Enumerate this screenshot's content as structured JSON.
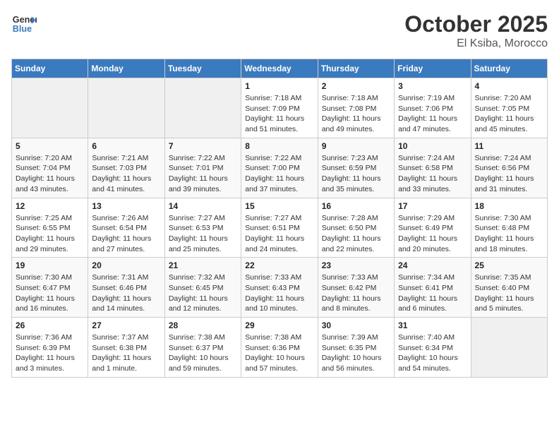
{
  "header": {
    "logo_line1": "General",
    "logo_line2": "Blue",
    "month": "October 2025",
    "location": "El Ksiba, Morocco"
  },
  "weekdays": [
    "Sunday",
    "Monday",
    "Tuesday",
    "Wednesday",
    "Thursday",
    "Friday",
    "Saturday"
  ],
  "weeks": [
    [
      {
        "day": "",
        "info": ""
      },
      {
        "day": "",
        "info": ""
      },
      {
        "day": "",
        "info": ""
      },
      {
        "day": "1",
        "info": "Sunrise: 7:18 AM\nSunset: 7:09 PM\nDaylight: 11 hours\nand 51 minutes."
      },
      {
        "day": "2",
        "info": "Sunrise: 7:18 AM\nSunset: 7:08 PM\nDaylight: 11 hours\nand 49 minutes."
      },
      {
        "day": "3",
        "info": "Sunrise: 7:19 AM\nSunset: 7:06 PM\nDaylight: 11 hours\nand 47 minutes."
      },
      {
        "day": "4",
        "info": "Sunrise: 7:20 AM\nSunset: 7:05 PM\nDaylight: 11 hours\nand 45 minutes."
      }
    ],
    [
      {
        "day": "5",
        "info": "Sunrise: 7:20 AM\nSunset: 7:04 PM\nDaylight: 11 hours\nand 43 minutes."
      },
      {
        "day": "6",
        "info": "Sunrise: 7:21 AM\nSunset: 7:03 PM\nDaylight: 11 hours\nand 41 minutes."
      },
      {
        "day": "7",
        "info": "Sunrise: 7:22 AM\nSunset: 7:01 PM\nDaylight: 11 hours\nand 39 minutes."
      },
      {
        "day": "8",
        "info": "Sunrise: 7:22 AM\nSunset: 7:00 PM\nDaylight: 11 hours\nand 37 minutes."
      },
      {
        "day": "9",
        "info": "Sunrise: 7:23 AM\nSunset: 6:59 PM\nDaylight: 11 hours\nand 35 minutes."
      },
      {
        "day": "10",
        "info": "Sunrise: 7:24 AM\nSunset: 6:58 PM\nDaylight: 11 hours\nand 33 minutes."
      },
      {
        "day": "11",
        "info": "Sunrise: 7:24 AM\nSunset: 6:56 PM\nDaylight: 11 hours\nand 31 minutes."
      }
    ],
    [
      {
        "day": "12",
        "info": "Sunrise: 7:25 AM\nSunset: 6:55 PM\nDaylight: 11 hours\nand 29 minutes."
      },
      {
        "day": "13",
        "info": "Sunrise: 7:26 AM\nSunset: 6:54 PM\nDaylight: 11 hours\nand 27 minutes."
      },
      {
        "day": "14",
        "info": "Sunrise: 7:27 AM\nSunset: 6:53 PM\nDaylight: 11 hours\nand 25 minutes."
      },
      {
        "day": "15",
        "info": "Sunrise: 7:27 AM\nSunset: 6:51 PM\nDaylight: 11 hours\nand 24 minutes."
      },
      {
        "day": "16",
        "info": "Sunrise: 7:28 AM\nSunset: 6:50 PM\nDaylight: 11 hours\nand 22 minutes."
      },
      {
        "day": "17",
        "info": "Sunrise: 7:29 AM\nSunset: 6:49 PM\nDaylight: 11 hours\nand 20 minutes."
      },
      {
        "day": "18",
        "info": "Sunrise: 7:30 AM\nSunset: 6:48 PM\nDaylight: 11 hours\nand 18 minutes."
      }
    ],
    [
      {
        "day": "19",
        "info": "Sunrise: 7:30 AM\nSunset: 6:47 PM\nDaylight: 11 hours\nand 16 minutes."
      },
      {
        "day": "20",
        "info": "Sunrise: 7:31 AM\nSunset: 6:46 PM\nDaylight: 11 hours\nand 14 minutes."
      },
      {
        "day": "21",
        "info": "Sunrise: 7:32 AM\nSunset: 6:45 PM\nDaylight: 11 hours\nand 12 minutes."
      },
      {
        "day": "22",
        "info": "Sunrise: 7:33 AM\nSunset: 6:43 PM\nDaylight: 11 hours\nand 10 minutes."
      },
      {
        "day": "23",
        "info": "Sunrise: 7:33 AM\nSunset: 6:42 PM\nDaylight: 11 hours\nand 8 minutes."
      },
      {
        "day": "24",
        "info": "Sunrise: 7:34 AM\nSunset: 6:41 PM\nDaylight: 11 hours\nand 6 minutes."
      },
      {
        "day": "25",
        "info": "Sunrise: 7:35 AM\nSunset: 6:40 PM\nDaylight: 11 hours\nand 5 minutes."
      }
    ],
    [
      {
        "day": "26",
        "info": "Sunrise: 7:36 AM\nSunset: 6:39 PM\nDaylight: 11 hours\nand 3 minutes."
      },
      {
        "day": "27",
        "info": "Sunrise: 7:37 AM\nSunset: 6:38 PM\nDaylight: 11 hours\nand 1 minute."
      },
      {
        "day": "28",
        "info": "Sunrise: 7:38 AM\nSunset: 6:37 PM\nDaylight: 10 hours\nand 59 minutes."
      },
      {
        "day": "29",
        "info": "Sunrise: 7:38 AM\nSunset: 6:36 PM\nDaylight: 10 hours\nand 57 minutes."
      },
      {
        "day": "30",
        "info": "Sunrise: 7:39 AM\nSunset: 6:35 PM\nDaylight: 10 hours\nand 56 minutes."
      },
      {
        "day": "31",
        "info": "Sunrise: 7:40 AM\nSunset: 6:34 PM\nDaylight: 10 hours\nand 54 minutes."
      },
      {
        "day": "",
        "info": ""
      }
    ]
  ]
}
